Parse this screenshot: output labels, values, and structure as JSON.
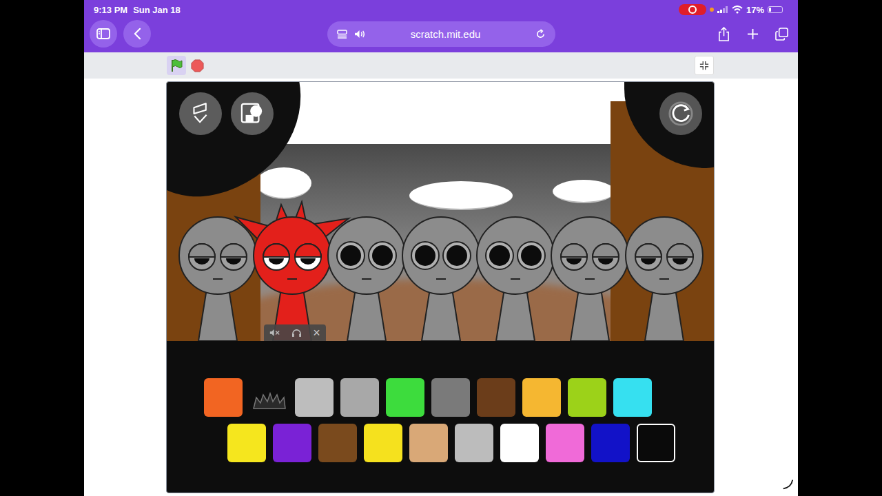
{
  "status_bar": {
    "time": "9:13 PM",
    "date": "Sun Jan 18",
    "battery": "17%",
    "battery_level": 0.17,
    "recording": true
  },
  "browser": {
    "url": "scratch.mit.edu"
  },
  "stage": {
    "characters": [
      {
        "kind": "plain",
        "color": "#8c8c8c",
        "eyes": "sleepy",
        "active": false
      },
      {
        "kind": "spiky",
        "color": "#e3201b",
        "eyes": "sleepy",
        "active": true
      },
      {
        "kind": "plain",
        "color": "#8c8c8c",
        "eyes": "open",
        "active": false
      },
      {
        "kind": "plain",
        "color": "#8c8c8c",
        "eyes": "open",
        "active": false
      },
      {
        "kind": "plain",
        "color": "#8c8c8c",
        "eyes": "open",
        "active": false
      },
      {
        "kind": "plain",
        "color": "#8c8c8c",
        "eyes": "sleepy",
        "active": false
      },
      {
        "kind": "plain",
        "color": "#8c8c8c",
        "eyes": "sleepy",
        "active": false
      }
    ],
    "mixer": {
      "close": "×"
    },
    "palette": [
      [
        {
          "color": "#f26522",
          "used": false
        },
        {
          "color": "#3a3a3a",
          "used": true
        },
        {
          "color": "#bdbdbd",
          "used": false
        },
        {
          "color": "#a8a8a8",
          "used": false
        },
        {
          "color": "#3ddc3d",
          "used": false
        },
        {
          "color": "#7a7a7a",
          "used": false
        },
        {
          "color": "#6b3d1a",
          "used": false
        },
        {
          "color": "#f5b731",
          "used": false
        },
        {
          "color": "#9cd219",
          "used": false
        },
        {
          "color": "#36e0f0",
          "used": false
        }
      ],
      [
        {
          "color": "#f5e61e",
          "used": false
        },
        {
          "color": "#7a22d6",
          "used": false
        },
        {
          "color": "#7a4a1d",
          "used": false
        },
        {
          "color": "#f5e11e",
          "used": false
        },
        {
          "color": "#d9a877",
          "used": false
        },
        {
          "color": "#bcbcbc",
          "used": false
        },
        {
          "color": "#ffffff",
          "used": false
        },
        {
          "color": "#f06ad8",
          "used": false
        },
        {
          "color": "#1212c8",
          "used": false
        },
        {
          "color": "#0a0a0a",
          "used": false
        }
      ]
    ]
  }
}
